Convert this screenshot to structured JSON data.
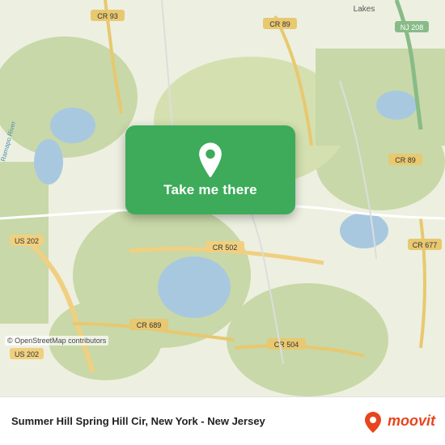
{
  "map": {
    "background_color": "#e8f0d8",
    "attribution": "© OpenStreetMap contributors"
  },
  "card": {
    "button_label": "Take me there",
    "background_color": "#3dab5a"
  },
  "bottom_bar": {
    "location_title": "Summer Hill Spring Hill Cir, New York - New Jersey",
    "moovit_text": "moovit"
  },
  "icons": {
    "pin": "location-pin-icon",
    "moovit_brand": "moovit-icon"
  }
}
